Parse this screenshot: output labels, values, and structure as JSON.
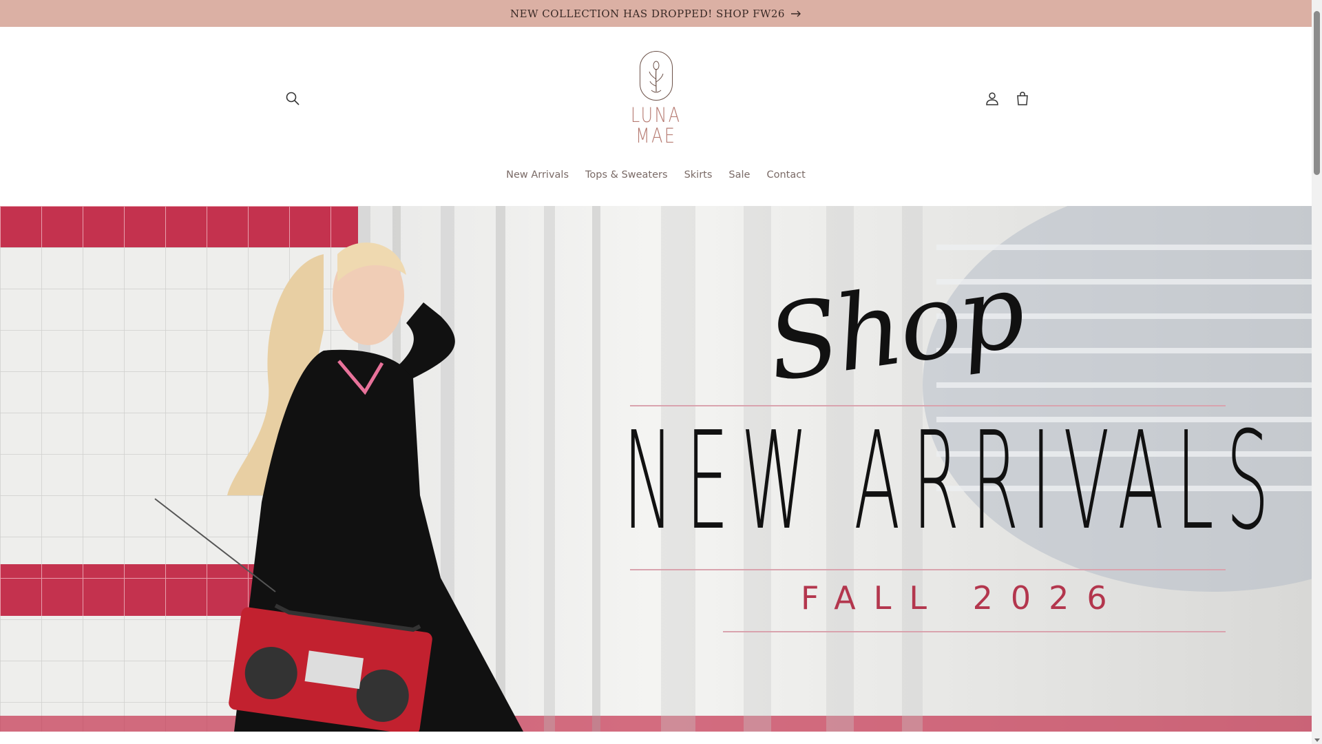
{
  "announcement": {
    "text": "NEW COLLECTION HAS DROPPED! SHOP FW26",
    "arrow_icon": "arrow-right-icon"
  },
  "header": {
    "logo_line1": "LUNA",
    "logo_line2": "MAE",
    "logo_color": "#b67b72",
    "icons": {
      "search": "search-icon",
      "account": "account-icon",
      "cart": "cart-icon"
    }
  },
  "nav": {
    "items": [
      {
        "label": "New Arrivals"
      },
      {
        "label": "Tops & Sweaters"
      },
      {
        "label": "Skirts"
      },
      {
        "label": "Sale"
      },
      {
        "label": "Contact"
      }
    ]
  },
  "hero": {
    "script_text": "Shop",
    "headline": "NEW ARRIVALS",
    "subheadline": "FALL 2026",
    "accent_color": "#b3364d"
  },
  "colors": {
    "announcement_bg": "#dbb0a4",
    "nav_text": "#7a6a66"
  }
}
